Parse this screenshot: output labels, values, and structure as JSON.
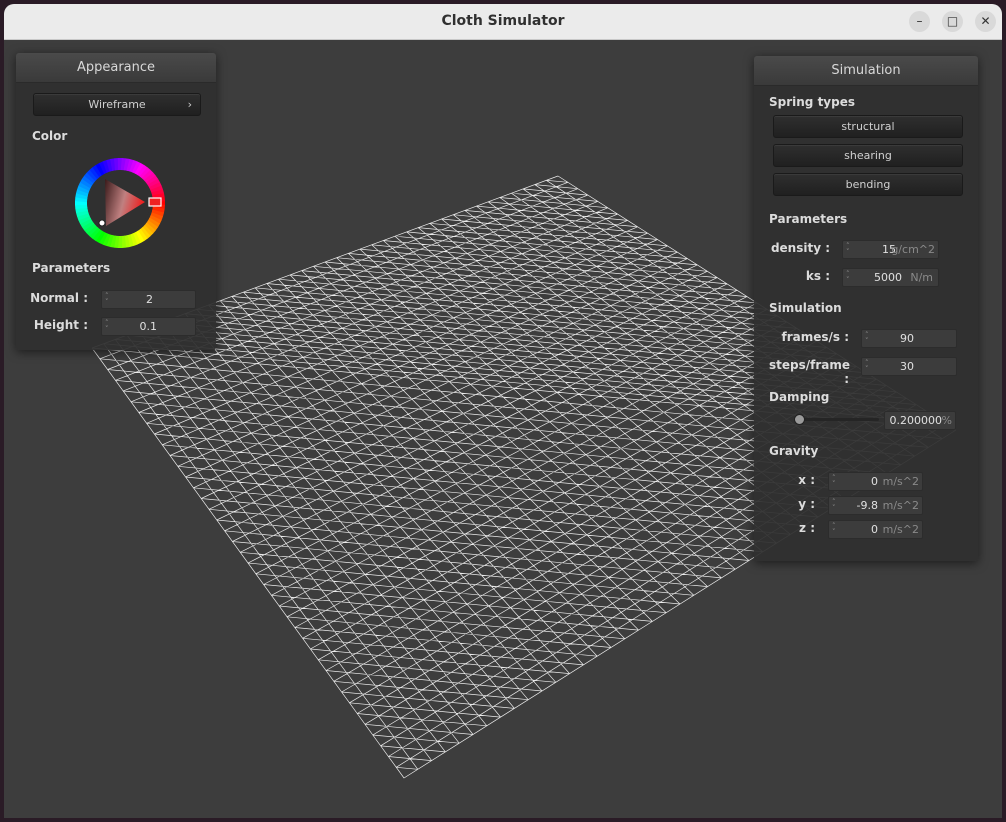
{
  "window": {
    "title": "Cloth Simulator"
  },
  "appearance": {
    "title": "Appearance",
    "shader_select": "Wireframe",
    "color_label": "Color",
    "parameters_label": "Parameters",
    "normal": {
      "label": "Normal :",
      "value": "2"
    },
    "height": {
      "label": "Height :",
      "value": "0.1"
    }
  },
  "simulation": {
    "title": "Simulation",
    "spring_types_label": "Spring types",
    "spring_buttons": [
      "structural",
      "shearing",
      "bending"
    ],
    "parameters_label": "Parameters",
    "density": {
      "label": "density :",
      "value": "15",
      "unit": "g/cm^2"
    },
    "ks": {
      "label": "ks :",
      "value": "5000",
      "unit": "N/m"
    },
    "simulation_label": "Simulation",
    "frames": {
      "label": "frames/s :",
      "value": "90"
    },
    "steps": {
      "label": "steps/frame :",
      "value": "30"
    },
    "damping_label": "Damping",
    "damping": {
      "value": "0.200000",
      "unit": "%",
      "slider_fraction": 0.0
    },
    "gravity_label": "Gravity",
    "gravity": {
      "x": {
        "label": "x :",
        "value": "0",
        "unit": "m/s^2"
      },
      "y": {
        "label": "y :",
        "value": "-9.8",
        "unit": "m/s^2"
      },
      "z": {
        "label": "z :",
        "value": "0",
        "unit": "m/s^2"
      }
    }
  },
  "colors": {
    "background": "#3d3d3d",
    "wireframe": "#ffffff",
    "picker_marker": "#e03030"
  }
}
